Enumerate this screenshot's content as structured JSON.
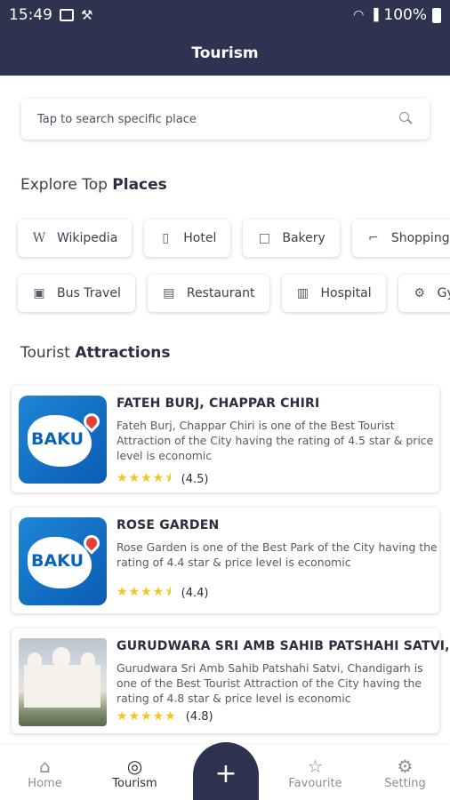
{
  "status_bar": {
    "time": "15:49",
    "battery": "100%"
  },
  "app_bar": {
    "title": "Tourism"
  },
  "search": {
    "placeholder": "Tap to search specific place"
  },
  "explore": {
    "title_prefix": "Explore Top",
    "title_bold": "Places",
    "row1": [
      {
        "icon": "W",
        "label": "Wikipedia"
      },
      {
        "icon": "▯",
        "label": "Hotel"
      },
      {
        "icon": "□",
        "label": "Bakery"
      },
      {
        "icon": "⌐",
        "label": "Shopping"
      }
    ],
    "row2": [
      {
        "icon": "▣",
        "label": "Bus Travel"
      },
      {
        "icon": "▤",
        "label": "Restaurant"
      },
      {
        "icon": "▥",
        "label": "Hospital"
      },
      {
        "icon": "⚙",
        "label": "Gy"
      }
    ]
  },
  "attractions": {
    "title_prefix": "Tourist",
    "title_bold": "Attractions",
    "items": [
      {
        "name": "FATEH BURJ, CHAPPAR CHIRI",
        "description": "Fateh Burj, Chappar Chiri is one of the Best Tourist Attraction of the City having the rating of 4.5 star & price level is economic",
        "stars": "★★★★⯨",
        "rating": "(4.5)",
        "thumb_text": "BAKU"
      },
      {
        "name": "ROSE GARDEN",
        "description": "Rose Garden is one of the Best Park of the City having the rating of 4.4 star & price level is economic",
        "stars": "★★★★⯨",
        "rating": "(4.4)",
        "thumb_text": "BAKU"
      },
      {
        "name": "GURUDWARA SRI AMB SAHIB PATSHAHI SATVI,",
        "description": "Gurudwara Sri Amb Sahib Patshahi Satvi, Chandigarh is one of the Best Tourist Attraction of the City having the rating of 4.8 star & price level is economic",
        "stars": "★★★★★",
        "rating": "(4.8)"
      }
    ]
  },
  "bottom_nav": {
    "home": "Home",
    "tourism": "Tourism",
    "add": "+",
    "favourite": "Favourite",
    "setting": "Setting"
  },
  "colors": {
    "primary": "#2e3350",
    "star": "#f5c518"
  }
}
